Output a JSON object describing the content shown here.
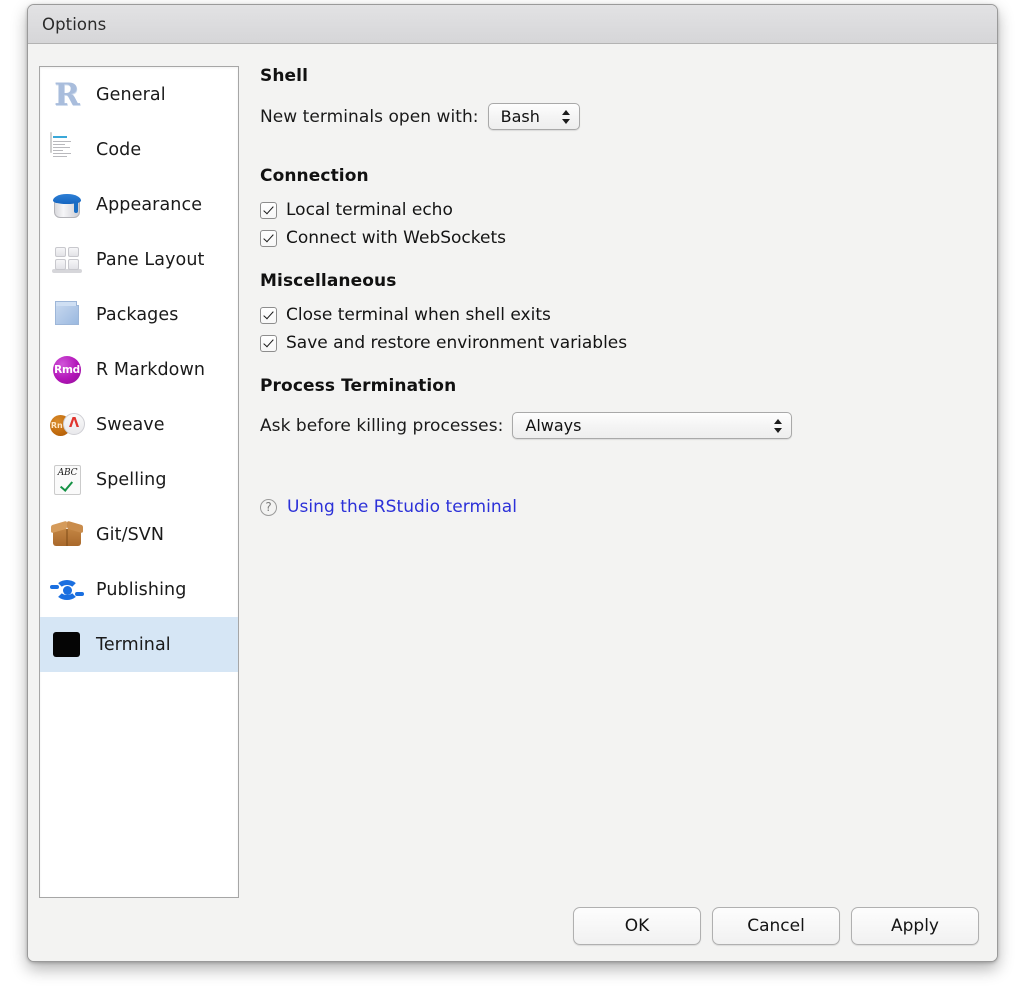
{
  "window": {
    "title": "Options"
  },
  "sidebar": {
    "items": [
      {
        "label": "General",
        "icon": "r-logo-icon",
        "selected": false
      },
      {
        "label": "Code",
        "icon": "code-document-icon",
        "selected": false
      },
      {
        "label": "Appearance",
        "icon": "paint-can-icon",
        "selected": false
      },
      {
        "label": "Pane Layout",
        "icon": "pane-grid-icon",
        "selected": false
      },
      {
        "label": "Packages",
        "icon": "package-box-icon",
        "selected": false
      },
      {
        "label": "R Markdown",
        "icon": "rmd-badge-icon",
        "selected": false
      },
      {
        "label": "Sweave",
        "icon": "sweave-rnw-pdf-icon",
        "selected": false
      },
      {
        "label": "Spelling",
        "icon": "spellcheck-icon",
        "selected": false
      },
      {
        "label": "Git/SVN",
        "icon": "carton-box-icon",
        "selected": false
      },
      {
        "label": "Publishing",
        "icon": "publish-ring-icon",
        "selected": false
      },
      {
        "label": "Terminal",
        "icon": "terminal-square-icon",
        "selected": true
      }
    ]
  },
  "main": {
    "shell": {
      "heading": "Shell",
      "new_terminals_label": "New terminals open with:",
      "shell_value": "Bash"
    },
    "connection": {
      "heading": "Connection",
      "checkboxes": [
        {
          "label": "Local terminal echo",
          "checked": true
        },
        {
          "label": "Connect with WebSockets",
          "checked": true
        }
      ]
    },
    "miscellaneous": {
      "heading": "Miscellaneous",
      "checkboxes": [
        {
          "label": "Close terminal when shell exits",
          "checked": true
        },
        {
          "label": "Save and restore environment variables",
          "checked": true
        }
      ]
    },
    "process_termination": {
      "heading": "Process Termination",
      "ask_label": "Ask before killing processes:",
      "ask_value": "Always"
    },
    "help": {
      "icon": "question-mark-icon",
      "link_text": "Using the RStudio terminal"
    }
  },
  "footer": {
    "ok_label": "OK",
    "cancel_label": "Cancel",
    "apply_label": "Apply"
  },
  "colors": {
    "selection": "#d6e6f5",
    "link": "#2c31d8",
    "window_bg": "#f3f3f2",
    "titlebar": "#dcdcde"
  }
}
